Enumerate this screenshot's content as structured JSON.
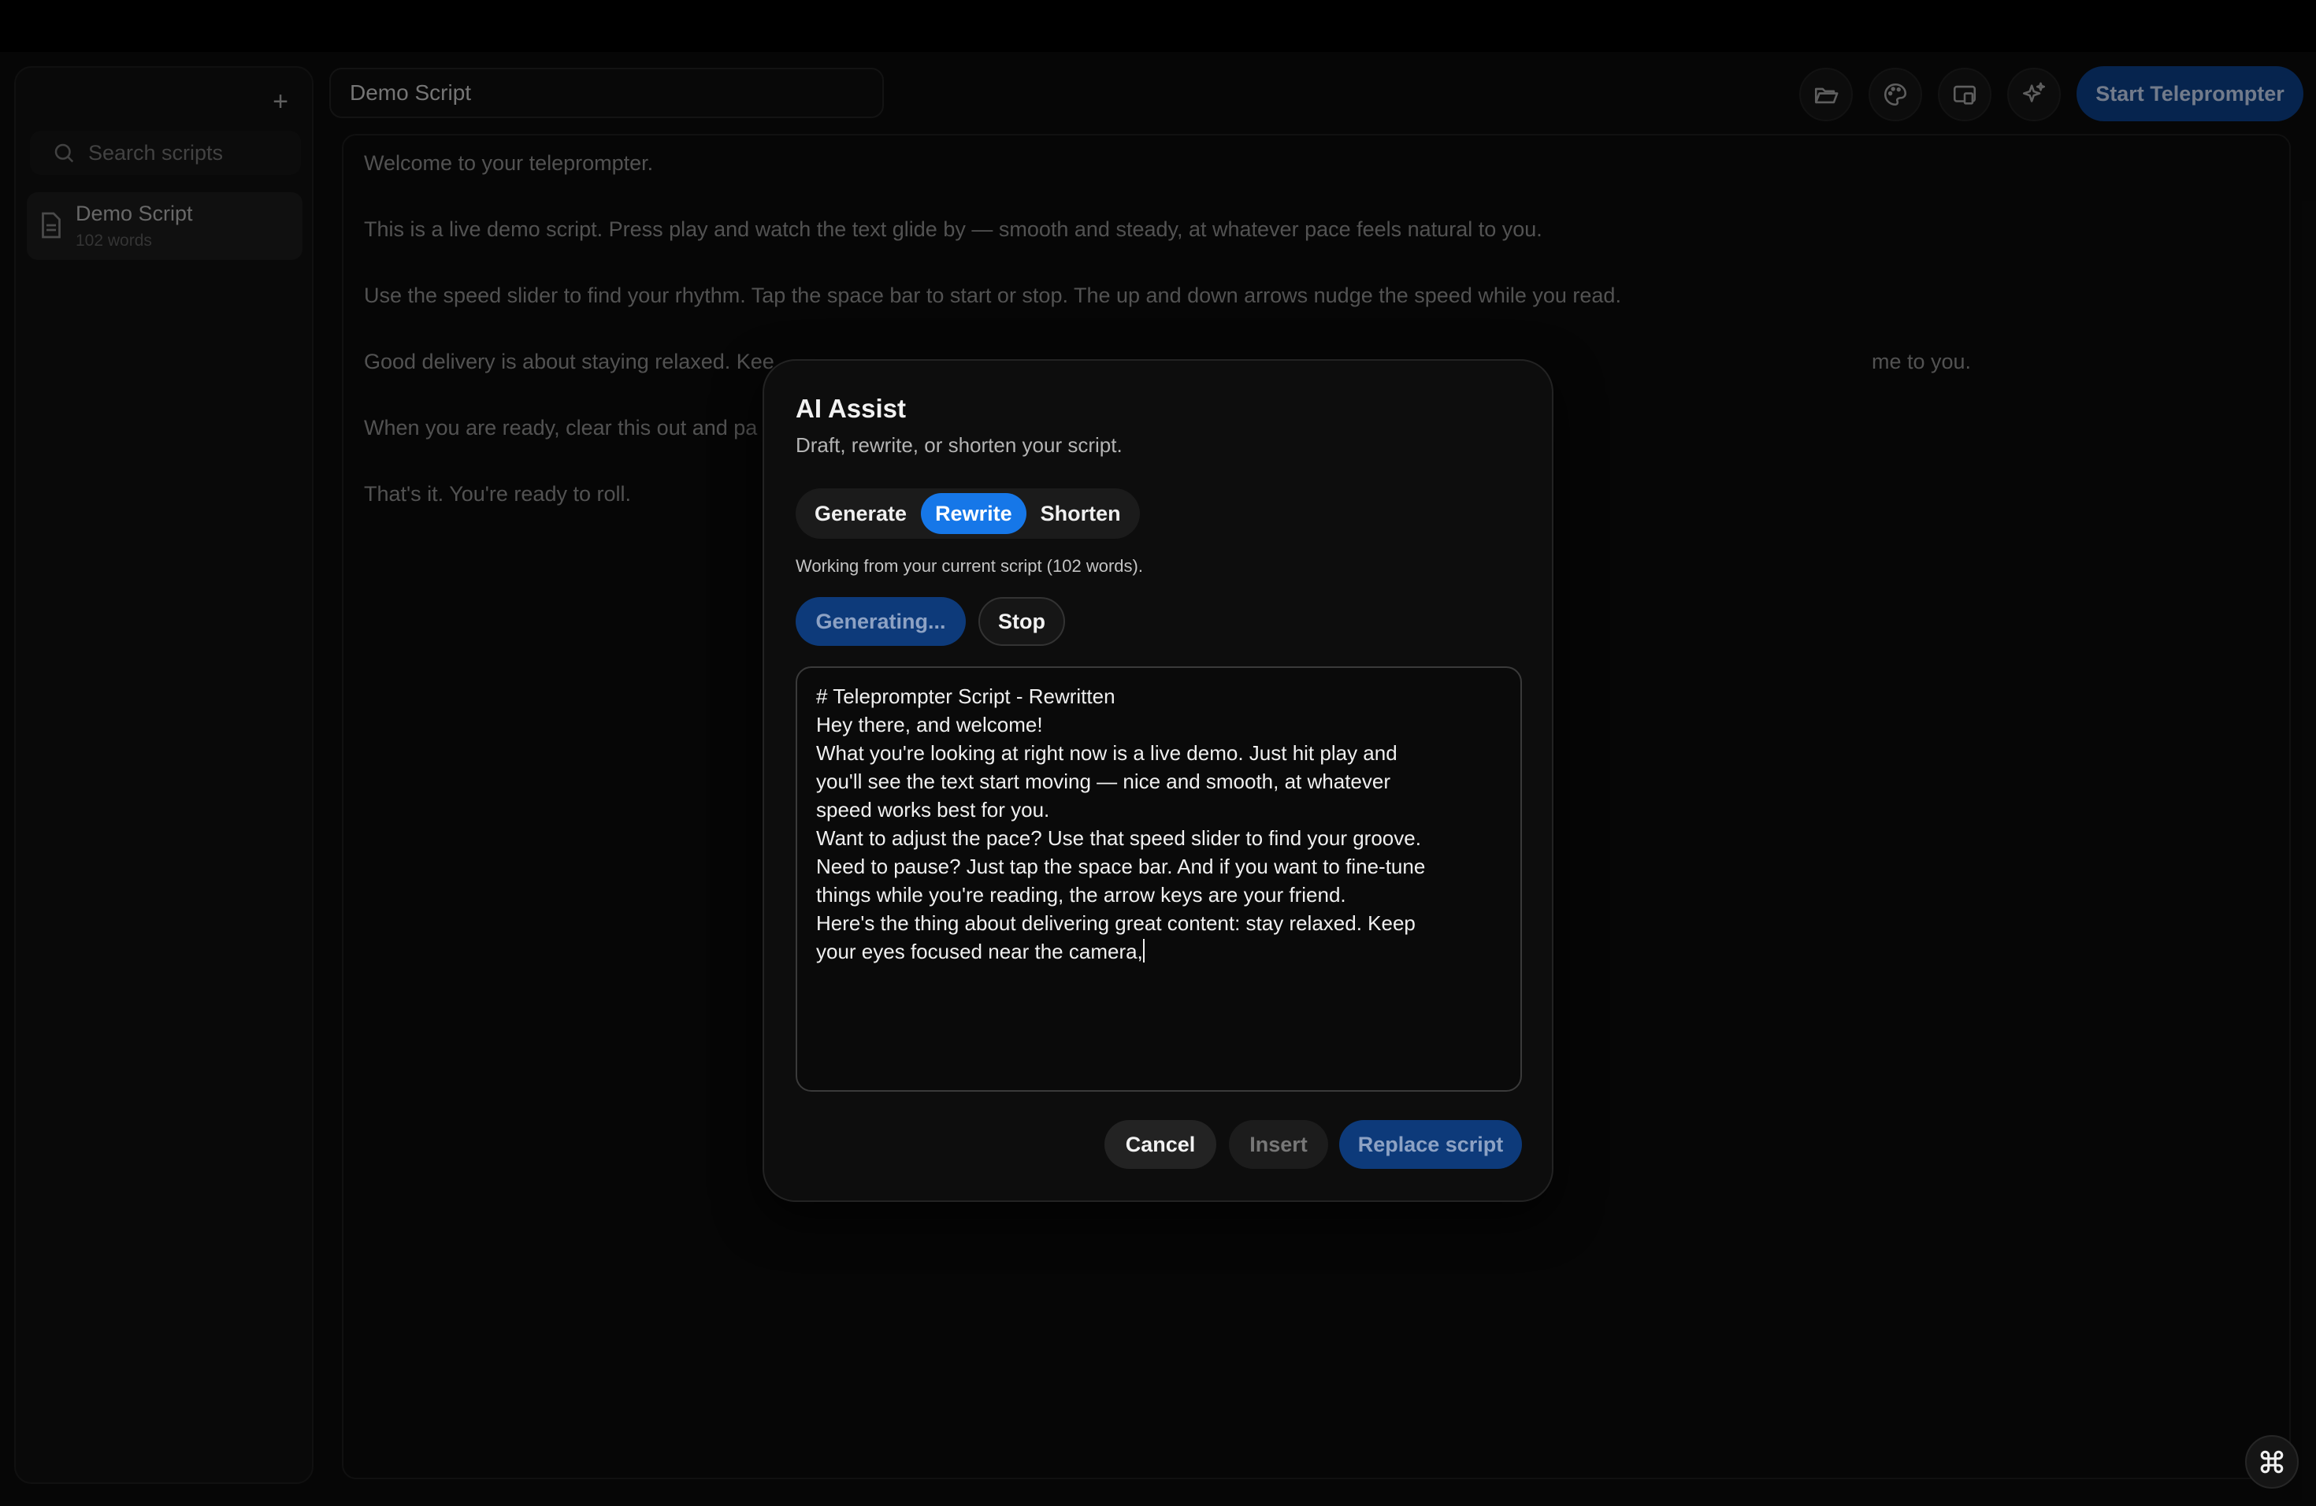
{
  "sidebar": {
    "add_icon": "plus-icon",
    "search_placeholder": "Search scripts",
    "items": [
      {
        "name": "Demo Script",
        "meta": "102 words",
        "icon": "document-icon"
      }
    ]
  },
  "header": {
    "title_value": "Demo Script",
    "icons": [
      "folder-open-icon",
      "palette-icon",
      "screen-cast-icon",
      "sparkles-icon"
    ],
    "start_label": "Start Teleprompter"
  },
  "editor": {
    "paragraphs": [
      "Welcome to your teleprompter.",
      "This is a live demo script. Press play and watch the text glide by — smooth and steady, at whatever pace feels natural to you.",
      "Use the speed slider to find your rhythm. Tap the space bar to start or stop. The up and down arrows nudge the speed while you read.",
      "Good delivery is about staying relaxed. Kee",
      "me to you.",
      "When you are ready, clear this out and pa",
      "That's it. You're ready to roll."
    ]
  },
  "modal": {
    "title": "AI Assist",
    "subtitle": "Draft, rewrite, or shorten your script.",
    "tabs": [
      {
        "label": "Generate",
        "active": false
      },
      {
        "label": "Rewrite",
        "active": true
      },
      {
        "label": "Shorten",
        "active": false
      }
    ],
    "info": "Working from your current script (102 words).",
    "generating_label": "Generating...",
    "stop_label": "Stop",
    "output_lines": [
      "# Teleprompter Script - Rewritten",
      "",
      "Hey there, and welcome!",
      "",
      "What you're looking at right now is a live demo. Just hit play and",
      "you'll see the text start moving — nice and smooth, at whatever",
      "speed works best for you.",
      "",
      "Want to adjust the pace? Use that speed slider to find your groove.",
      "Need to pause? Just tap the space bar. And if you want to fine-tune",
      "things while you're reading, the arrow keys are your friend.",
      "",
      "Here's the thing about delivering great content: stay relaxed. Keep",
      "your eyes focused near the camera,"
    ],
    "cancel_label": "Cancel",
    "insert_label": "Insert",
    "replace_label": "Replace script"
  },
  "colors": {
    "accent": "#1677e8",
    "accent_dim": "#0d3a7a"
  },
  "corner_icon": "command-key-icon"
}
